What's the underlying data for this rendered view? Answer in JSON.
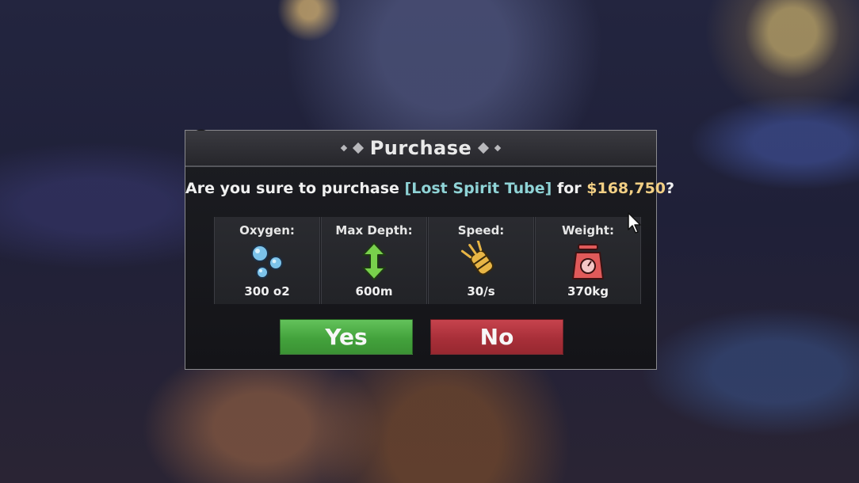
{
  "dialog": {
    "title": "Purchase",
    "question_prefix": "Are you sure to purchase ",
    "item_name": "[Lost Spirit Tube]",
    "question_mid": " for ",
    "price": "$168,750",
    "question_suffix": "?"
  },
  "stats": [
    {
      "label": "Oxygen:",
      "value": "300 o2",
      "icon": "oxygen-bubbles-icon"
    },
    {
      "label": "Max Depth:",
      "value": "600m",
      "icon": "depth-arrows-icon"
    },
    {
      "label": "Speed:",
      "value": "30/s",
      "icon": "propeller-icon"
    },
    {
      "label": "Weight:",
      "value": "370kg",
      "icon": "weight-scale-icon"
    }
  ],
  "buttons": {
    "yes_label": "Yes",
    "no_label": "No"
  },
  "colors": {
    "item_name": "#8fd3d6",
    "price": "#f2cf84",
    "yes": "#4caf44",
    "no": "#b0343f"
  }
}
